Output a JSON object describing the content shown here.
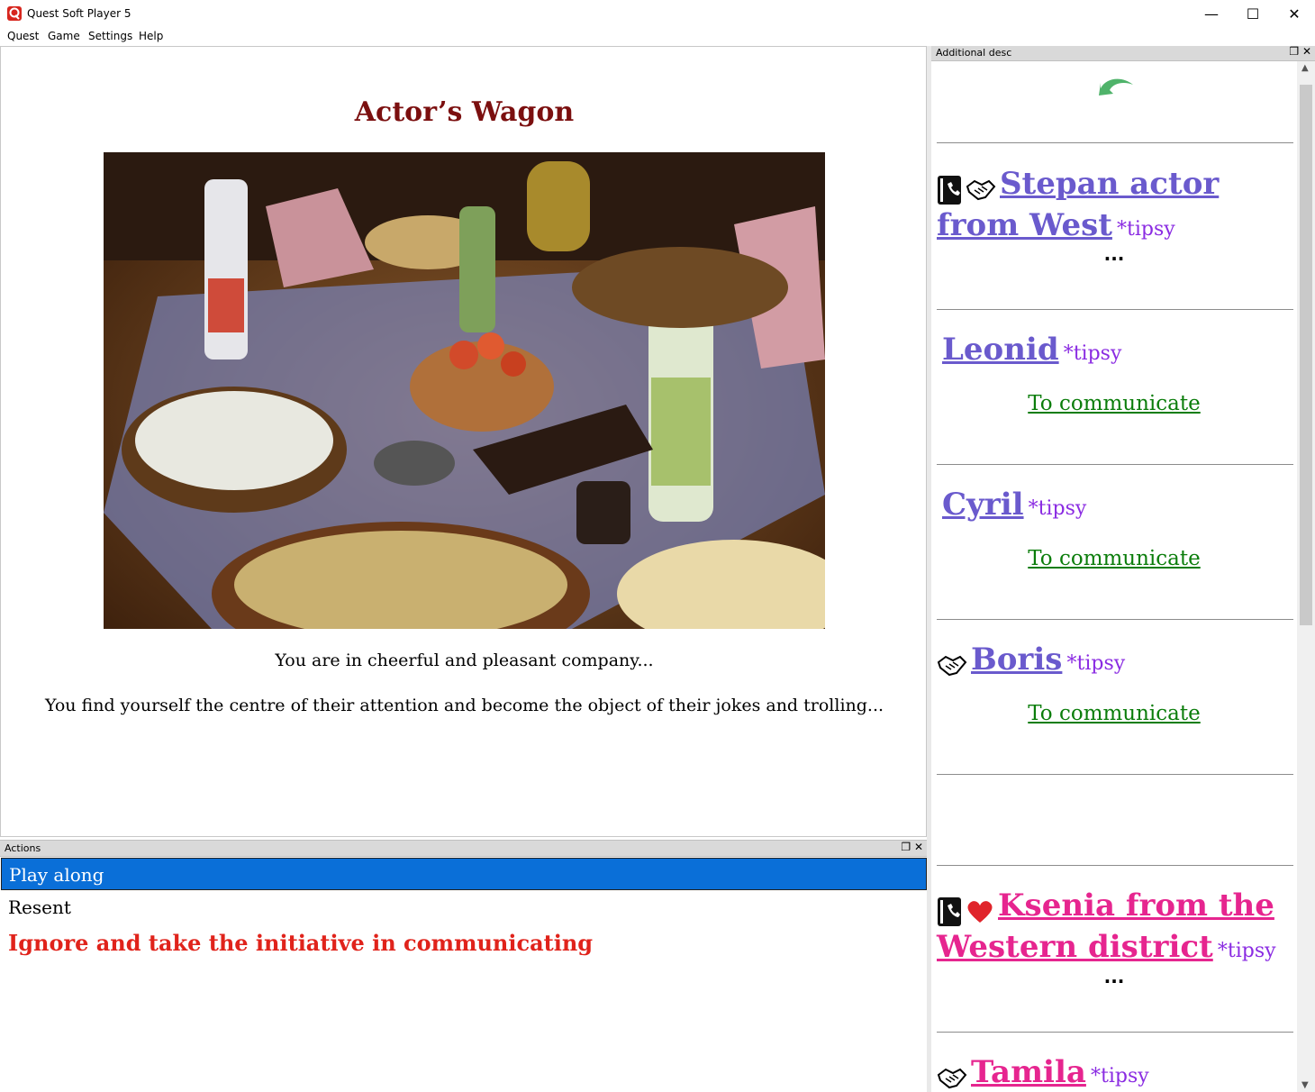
{
  "window": {
    "title": "Quest Soft Player 5",
    "minimize": "—",
    "maximize": "☐",
    "close": "✕"
  },
  "menu": [
    {
      "label": "Quest"
    },
    {
      "label": "Game"
    },
    {
      "label": "Settings"
    },
    {
      "label": "Help"
    }
  ],
  "main": {
    "location_title": "Actor’s Wagon",
    "paragraph1": "You are in cheerful and pleasant company...",
    "paragraph2": "You find yourself the centre of their attention and become the object of their jokes and trolling..."
  },
  "actions_panel": {
    "title": "Actions",
    "items": [
      {
        "label": "Play along",
        "selected": true
      },
      {
        "label": "Resent"
      },
      {
        "label": "Ignore and take the initiative in communicating",
        "color": "#e0231b"
      }
    ]
  },
  "side_panel": {
    "title": "Additional desc",
    "npcs": [
      {
        "name_line1": "Stepan actor ",
        "name_line2": "from West",
        "status": "*tipsy",
        "extra": "..."
      },
      {
        "name": "Leonid",
        "status": "*tipsy",
        "action": "To communicate"
      },
      {
        "name": "Cyril",
        "status": "*tipsy",
        "action": "To communicate"
      },
      {
        "name": "Boris",
        "status": "*tipsy",
        "action": "To communicate"
      },
      {
        "name_line1": "Ksenia from the ",
        "name_line2": "Western district",
        "status": "*tipsy",
        "extra": "..."
      },
      {
        "name": "Tamila",
        "status": "*tipsy"
      }
    ]
  },
  "colors": {
    "title": "#7b0f0f",
    "npc_blue": "#6a5acd",
    "npc_pink": "#e6258f",
    "communicate": "#0b7d0b",
    "selection": "#0a6fd8"
  }
}
